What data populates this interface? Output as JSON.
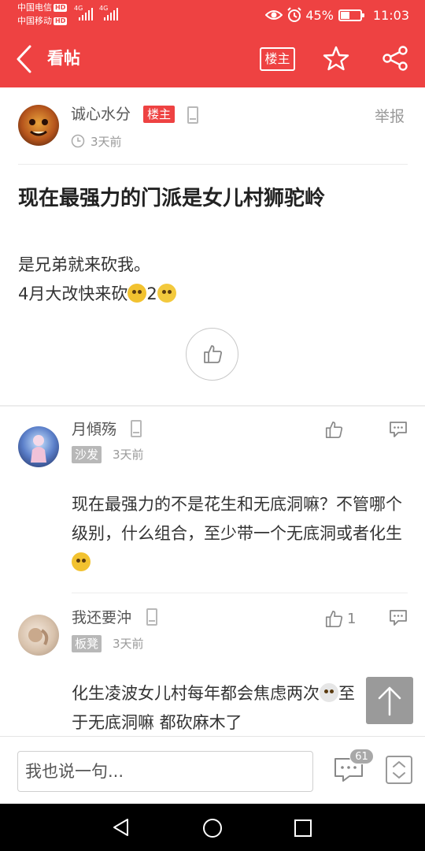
{
  "status_bar": {
    "carrier1": "中国电信",
    "carrier2": "中国移动",
    "hd_badge": "HD",
    "network": "4G",
    "battery_percent": "45%",
    "battery_level": 0.45,
    "time": "11:03"
  },
  "header": {
    "title": "看帖",
    "op_only_label": "楼主"
  },
  "post": {
    "author": "诚心水分",
    "op_badge": "楼主",
    "time": "3天前",
    "report_label": "举报",
    "title": "现在最强力的门派是女儿村狮驼岭",
    "body_line1": "是兄弟就来砍我。",
    "body_line2": "4月大改快来砍",
    "body_line2_tail": "2"
  },
  "replies": [
    {
      "author": "月傾殇",
      "floor": "沙发",
      "time": "3天前",
      "likes": "",
      "text": "现在最强力的不是花生和无底洞嘛？不管哪个级别，什么组合，至少带一个无底洞或者化生"
    },
    {
      "author": "我还要沖",
      "floor": "板凳",
      "time": "3天前",
      "likes": "1",
      "text_line1": "化生凌波女儿村每年都会焦虑两次",
      "text_line1_tail": "至",
      "text_line2": "于无底洞嘛 都砍麻木了"
    }
  ],
  "bottom_bar": {
    "input_placeholder": "我也说一句...",
    "comment_count": "61"
  },
  "colors": {
    "brand_red": "#ee4242",
    "tag_gray": "#b8b8b8"
  }
}
